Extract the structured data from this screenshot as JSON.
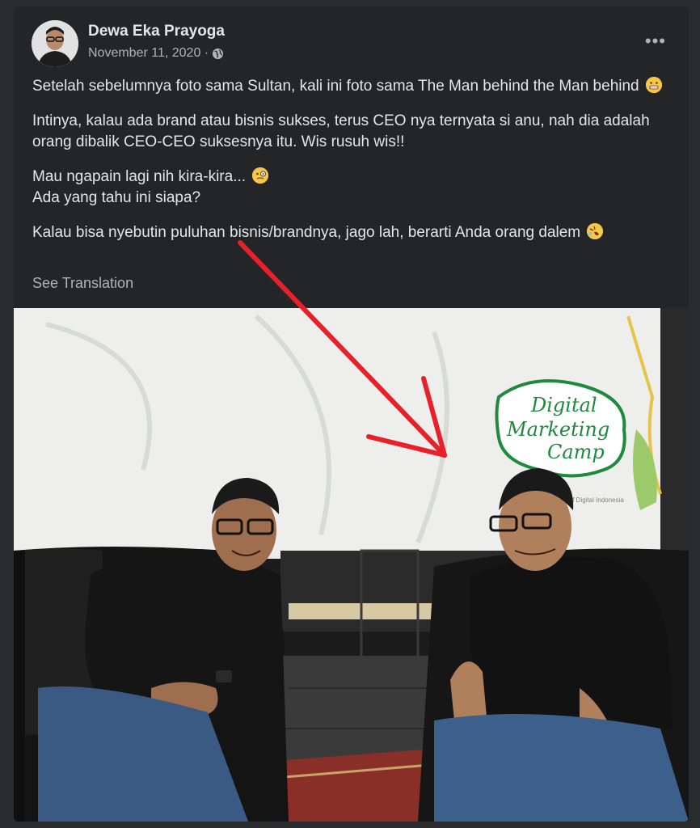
{
  "post": {
    "author": "Dewa Eka Prayoga",
    "date": "November 11, 2020 ·",
    "visibility_icon": "globe-icon",
    "more_label": "•••",
    "paragraphs": [
      "Setelah sebelumnya foto sama Sultan, kali ini foto sama The Man behind the Man behind",
      "Intinya, kalau ada brand atau bisnis sukses, terus CEO nya ternyata si anu, nah dia adalah orang dibalik CEO-CEO suksesnya itu. Wis rusuh wis!!",
      "Mau ngapain lagi nih kira-kira...",
      "Ada yang tahu ini siapa?",
      "Kalau bisa nyebutin puluhan bisnis/brandnya, jago lah, berarti Anda orang dalem"
    ],
    "see_translation": "See Translation"
  },
  "photo": {
    "banner_text_1": "Digital",
    "banner_text_2": "Marketing",
    "banner_text_3": "Camp",
    "banner_small": "Of Digital Indonesia"
  },
  "colors": {
    "background": "#242526",
    "text_primary": "#e4e6eb",
    "text_secondary": "#b0b3b8",
    "arrow": "#e8202a",
    "banner_green": "#1f8a3d"
  }
}
